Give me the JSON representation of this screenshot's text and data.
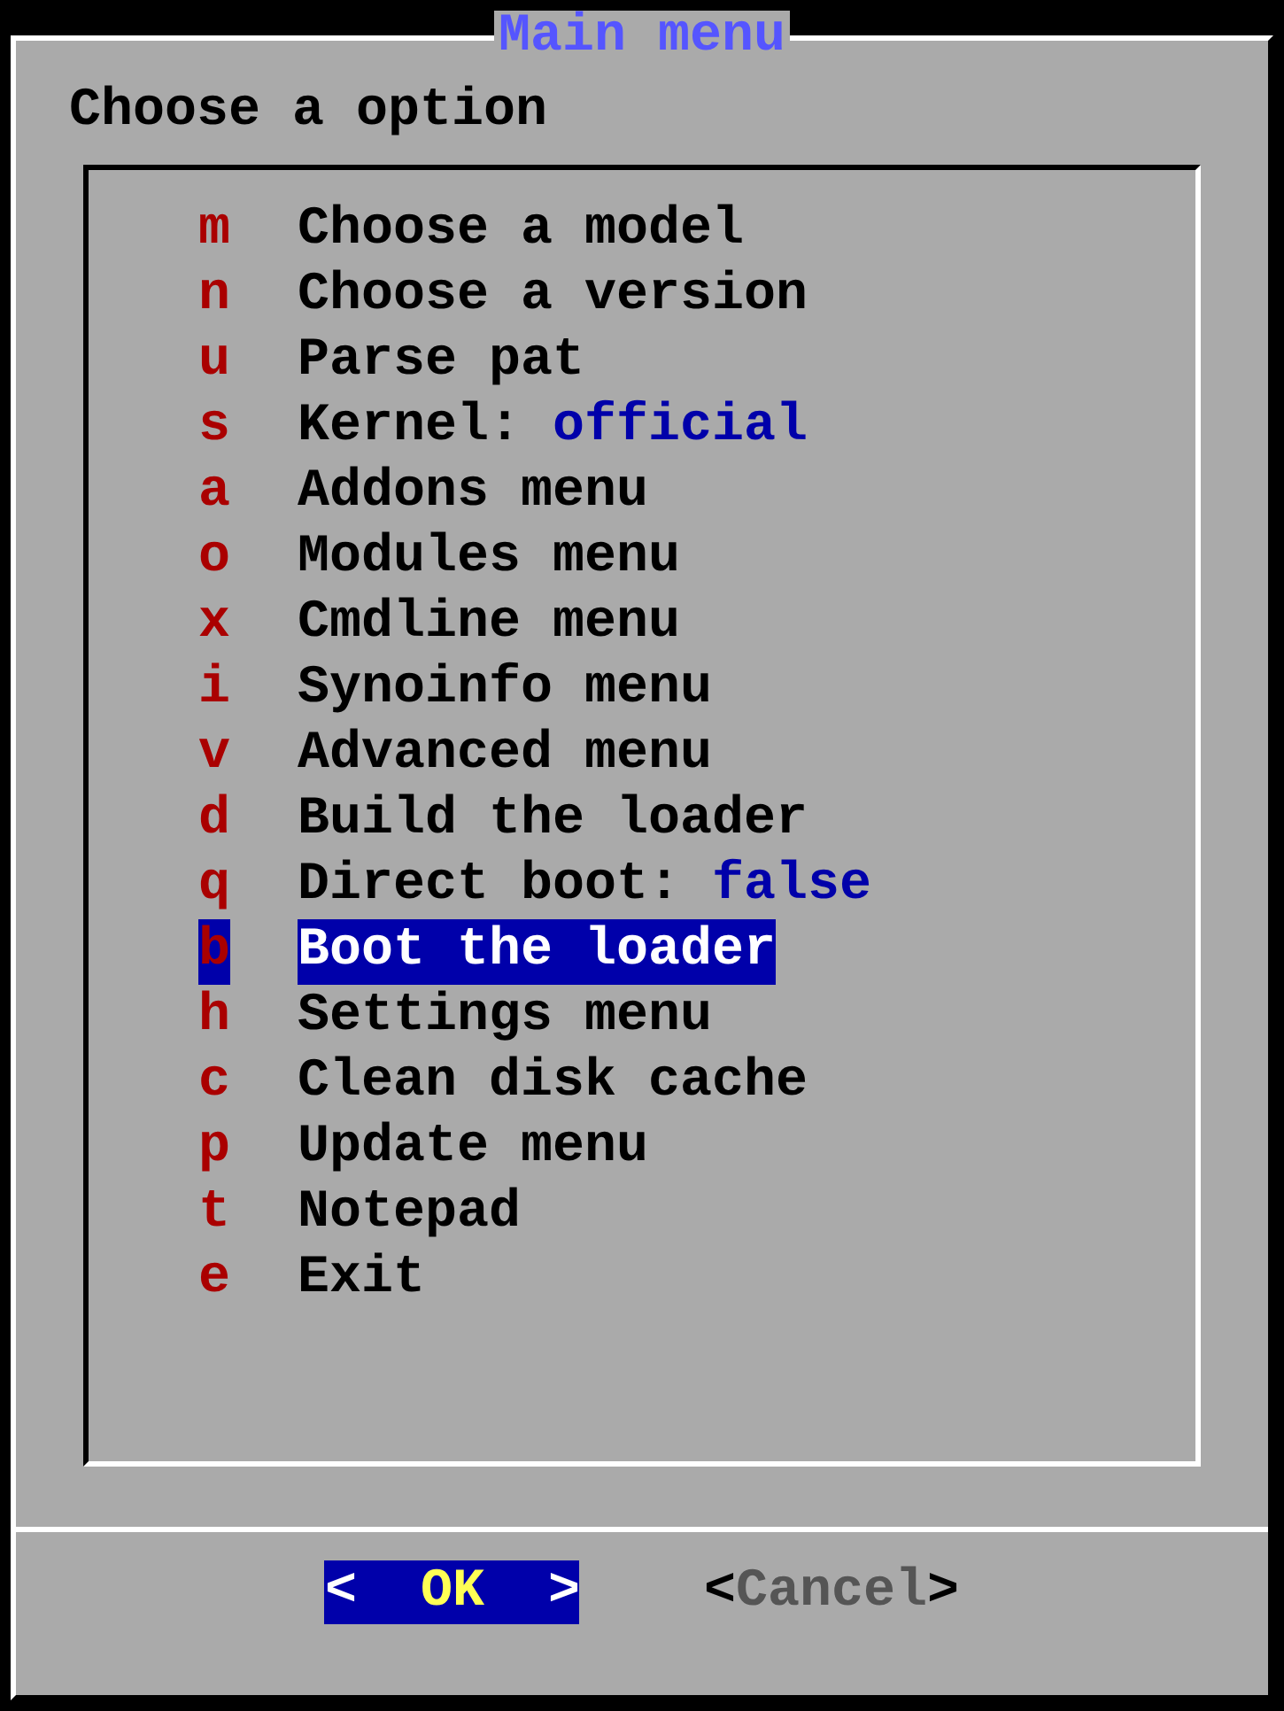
{
  "dialog": {
    "title": "Main menu",
    "prompt": "Choose a option"
  },
  "menu": [
    {
      "key": "m",
      "label": "Choose a model",
      "selected": false
    },
    {
      "key": "n",
      "label": "Choose a version",
      "selected": false
    },
    {
      "key": "u",
      "label": "Parse pat",
      "selected": false
    },
    {
      "key": "s",
      "label": "Kernel:",
      "value": "official",
      "selected": false
    },
    {
      "key": "a",
      "label": "Addons menu",
      "selected": false
    },
    {
      "key": "o",
      "label": "Modules menu",
      "selected": false
    },
    {
      "key": "x",
      "label": "Cmdline menu",
      "selected": false
    },
    {
      "key": "i",
      "label": "Synoinfo menu",
      "selected": false
    },
    {
      "key": "v",
      "label": "Advanced menu",
      "selected": false
    },
    {
      "key": "d",
      "label": "Build the loader",
      "selected": false
    },
    {
      "key": "q",
      "label": "Direct boot:",
      "value": "false",
      "selected": false
    },
    {
      "key": "b",
      "label": "Boot the loader",
      "selected": true
    },
    {
      "key": "h",
      "label": "Settings menu",
      "selected": false
    },
    {
      "key": "c",
      "label": "Clean disk cache",
      "selected": false
    },
    {
      "key": "p",
      "label": "Update menu",
      "selected": false
    },
    {
      "key": "t",
      "label": "Notepad",
      "selected": false
    },
    {
      "key": "e",
      "label": "Exit",
      "selected": false
    }
  ],
  "buttons": [
    {
      "open": "<",
      "label": "OK",
      "close": ">",
      "selected": true
    },
    {
      "open": "<",
      "label": "Cancel",
      "close": ">",
      "selected": false
    }
  ]
}
